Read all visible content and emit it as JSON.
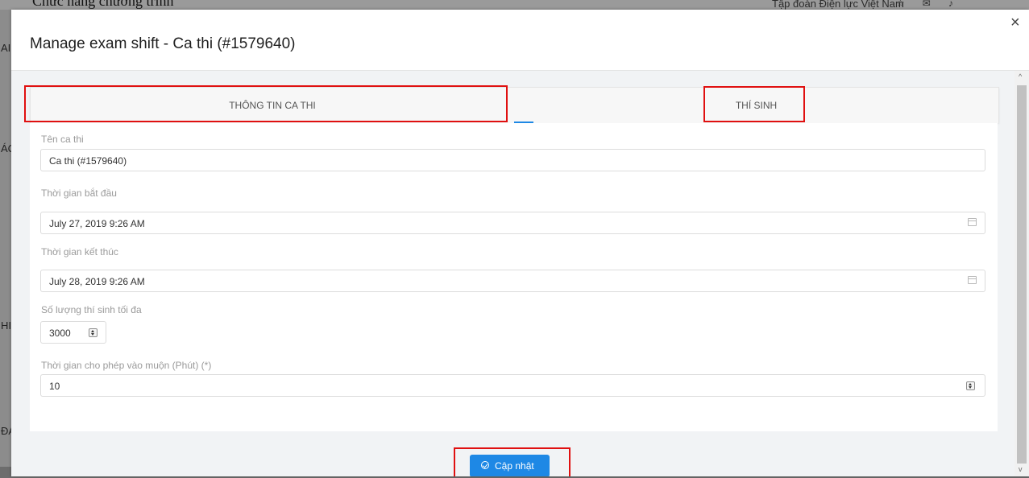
{
  "background": {
    "top_left_text": "Chức năng chương trình",
    "top_right_text": "Tập đoàn Điện lực Việt Nam",
    "top_right_icons": [
      "star-icon",
      "mail-icon",
      "bell-icon"
    ],
    "left_fragments": [
      "AI",
      "ÁC",
      "HI",
      "ĐA"
    ]
  },
  "modal": {
    "title": "Manage exam shift - Ca thi (#1579640)",
    "close_symbol": "×",
    "tabs": [
      {
        "label": "THÔNG TIN CA THI",
        "active": true
      },
      {
        "label": "THÍ SINH",
        "active": false
      }
    ],
    "form": {
      "exam_name": {
        "label": "Tên ca thi",
        "value": "Ca thi (#1579640)"
      },
      "start_time": {
        "label": "Thời gian bắt đầu",
        "value": "July 27, 2019 9:26 AM",
        "icon": "calendar-icon"
      },
      "end_time": {
        "label": "Thời gian kết thúc",
        "value": "July 28, 2019 9:26 AM",
        "icon": "calendar-icon"
      },
      "max_candidates": {
        "label": "Số lượng thí sinh tối đa",
        "value": "3000"
      },
      "late_allowance": {
        "label": "Thời gian cho phép vào muộn (Phút) (*)",
        "value": "10"
      }
    },
    "update_button": {
      "label": "Cập nhật",
      "icon": "check-circle-icon"
    }
  },
  "colors": {
    "accent": "#1e88e5",
    "highlight_box": "#e01010",
    "overlay": "#8c8c8c"
  }
}
